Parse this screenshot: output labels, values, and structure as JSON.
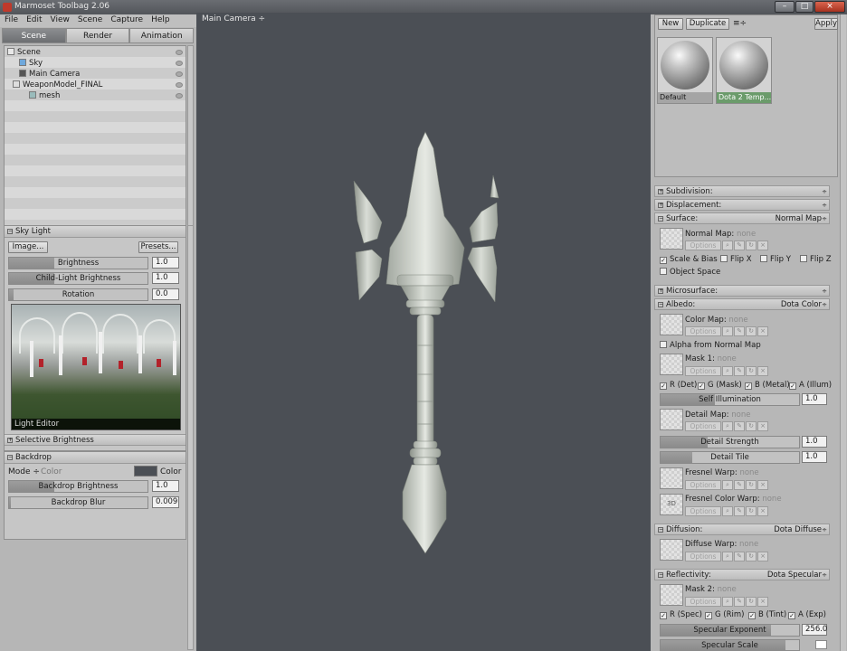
{
  "window": {
    "title": "Marmoset Toolbag 2.06",
    "buttons": [
      "–",
      "□",
      "×"
    ]
  },
  "menu": [
    "File",
    "Edit",
    "View",
    "Scene",
    "Capture",
    "Help"
  ],
  "tabs": [
    "Scene",
    "Render",
    "Animation"
  ],
  "outliner": {
    "items": [
      {
        "label": "Scene"
      },
      {
        "label": "Sky"
      },
      {
        "label": "Main Camera"
      },
      {
        "label": "WeaponModel_FINAL"
      },
      {
        "label": "mesh"
      }
    ]
  },
  "sky_light": {
    "title": "Sky Light",
    "image_button": "Image...",
    "presets_button": "Presets...",
    "brightness": {
      "label": "Brightness",
      "value": "1.0"
    },
    "child_light": {
      "label": "Child-Light Brightness",
      "value": "1.0"
    },
    "rotation": {
      "label": "Rotation",
      "value": "0.0"
    },
    "image_caption": "Light Editor",
    "selective": "Selective Brightness"
  },
  "backdrop": {
    "title": "Backdrop",
    "mode_label": "Mode ÷",
    "mode_value": "Color",
    "color_label": "Color",
    "brightness": {
      "label": "Backdrop Brightness",
      "value": "1.0"
    },
    "blur": {
      "label": "Backdrop Blur",
      "value": "0.009"
    }
  },
  "viewport": {
    "camera": "Main Camera ÷",
    "bg_color": "#4b4f55"
  },
  "materials": {
    "new": "New",
    "duplicate": "Duplicate",
    "menu": "≡÷",
    "apply": "Apply",
    "items": [
      {
        "name": "Default"
      },
      {
        "name": "Dota 2 Temp..."
      }
    ]
  },
  "props": {
    "subdivision": "Subdivision:",
    "displacement": "Displacement:",
    "surface": {
      "label": "Surface:",
      "value": "Normal Map"
    },
    "normal_map": {
      "label": "Normal Map:",
      "value": "none"
    },
    "options": "Options",
    "scale_bias": "Scale & Bias",
    "flip_x": "Flip X",
    "flip_y": "Flip Y",
    "flip_z": "Flip Z",
    "object_space": "Object Space",
    "microsurface": "Microsurface:",
    "albedo": {
      "label": "Albedo:",
      "value": "Dota Color"
    },
    "color_map": {
      "label": "Color Map:",
      "value": "none"
    },
    "alpha_normal": "Alpha from Normal Map",
    "mask1": {
      "label": "Mask 1:",
      "value": "none"
    },
    "mask1_ch": [
      "R (Det)",
      "G (Mask)",
      "B (Metal)",
      "A (Illum)"
    ],
    "self_illum": {
      "label": "Self Illumination",
      "value": "1.0"
    },
    "detail_map": {
      "label": "Detail Map:",
      "value": "none"
    },
    "detail_strength": {
      "label": "Detail Strength",
      "value": "1.0"
    },
    "detail_tile": {
      "label": "Detail Tile",
      "value": "1.0"
    },
    "fresnel_warp": {
      "label": "Fresnel Warp:",
      "value": "none"
    },
    "fresnel_color_warp": {
      "label": "Fresnel Color Warp:",
      "value": "none"
    },
    "diffusion": {
      "label": "Diffusion:",
      "value": "Dota Diffuse"
    },
    "diffuse_warp": {
      "label": "Diffuse Warp:",
      "value": "none"
    },
    "reflectivity": {
      "label": "Reflectivity:",
      "value": "Dota Specular"
    },
    "mask2": {
      "label": "Mask 2:",
      "value": "none"
    },
    "mask2_ch": [
      "R (Spec)",
      "G (Rim)",
      "B (Tint)",
      "A (Exp)"
    ],
    "spec_exp": {
      "label": "Specular Exponent",
      "value": "256.0"
    },
    "spec_scale": {
      "label": "Specular Scale"
    },
    "thumb_3d": "3D"
  }
}
